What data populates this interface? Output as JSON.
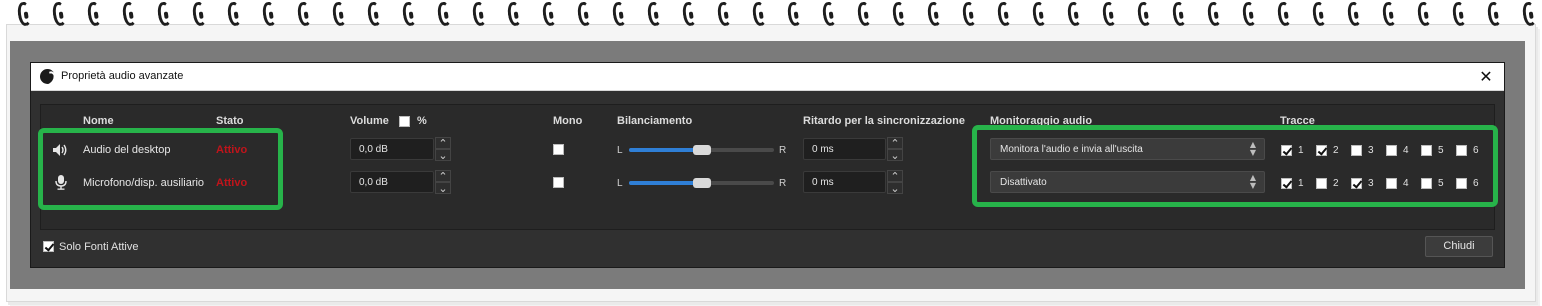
{
  "dialog": {
    "title": "Proprietà audio avanzate",
    "close_symbol": "✕"
  },
  "headers": {
    "name": "Nome",
    "state": "Stato",
    "volume": "Volume",
    "percent": "%",
    "mono": "Mono",
    "balance": "Bilanciamento",
    "sync_offset": "Ritardo per la sincronizzazione",
    "monitoring": "Monitoraggio audio",
    "tracks": "Tracce"
  },
  "rows": [
    {
      "icon": "speaker-icon",
      "name": "Audio del desktop",
      "state": "Attivo",
      "volume": "0,0 dB",
      "mono": false,
      "balance_left": "L",
      "balance_right": "R",
      "balance_value": 0.5,
      "sync": "0 ms",
      "monitoring": "Monitora l'audio e invia all'uscita",
      "tracks": [
        {
          "label": "1",
          "checked": true
        },
        {
          "label": "2",
          "checked": true
        },
        {
          "label": "3",
          "checked": false
        },
        {
          "label": "4",
          "checked": false
        },
        {
          "label": "5",
          "checked": false
        },
        {
          "label": "6",
          "checked": false
        }
      ]
    },
    {
      "icon": "microphone-icon",
      "name": "Microfono/disp. ausiliario",
      "state": "Attivo",
      "volume": "0,0 dB",
      "mono": false,
      "balance_left": "L",
      "balance_right": "R",
      "balance_value": 0.5,
      "sync": "0 ms",
      "monitoring": "Disattivato",
      "tracks": [
        {
          "label": "1",
          "checked": true
        },
        {
          "label": "2",
          "checked": false
        },
        {
          "label": "3",
          "checked": true
        },
        {
          "label": "4",
          "checked": false
        },
        {
          "label": "5",
          "checked": false
        },
        {
          "label": "6",
          "checked": false
        }
      ]
    }
  ],
  "footer": {
    "active_only_label": "Solo Fonti Attive",
    "active_only_checked": true,
    "close_button": "Chiudi"
  },
  "colors": {
    "highlight": "#27b34a",
    "active_state": "#c0141b",
    "slider_fill": "#2f7fd6"
  }
}
